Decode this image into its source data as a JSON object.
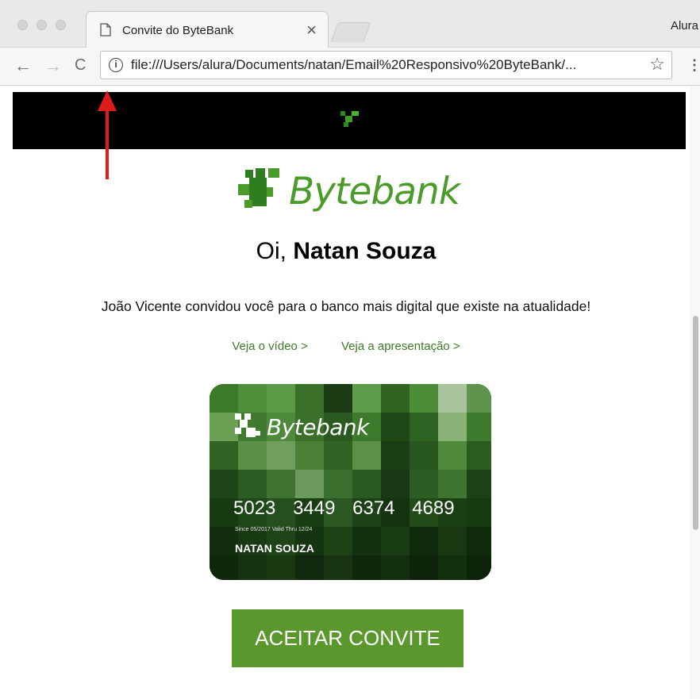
{
  "tab": {
    "title": "Convite do ByteBank",
    "close": "×"
  },
  "profile": {
    "name": "Alura"
  },
  "toolbar": {
    "back": "←",
    "forward": "→",
    "reload": "C",
    "url": "file:///Users/alura/Documents/natan/Email%20Responsivo%20ByteBank/...",
    "bookmark": "☆",
    "menu": "⋮"
  },
  "email": {
    "brand": "Bytebank",
    "greeting_prefix": "Oi, ",
    "greeting_name": "Natan Souza",
    "invite_text": "João Vicente convidou você para o banco mais digital que existe na atualidade!",
    "link_video": "Veja o vídeo >",
    "link_presentation": "Veja a apresentação >",
    "card": {
      "brand": "Bytebank",
      "number": [
        "5023",
        "3449",
        "6374",
        "4689"
      ],
      "validity": "Since 05/2017  Valid Thru 12/24",
      "holder": "NATAN SOUZA"
    },
    "cta": "ACEITAR CONVITE"
  },
  "colors": {
    "brand_green": "#4b9b2b",
    "button_green": "#5a982d",
    "annotation_arrow": "#e01b1b"
  }
}
